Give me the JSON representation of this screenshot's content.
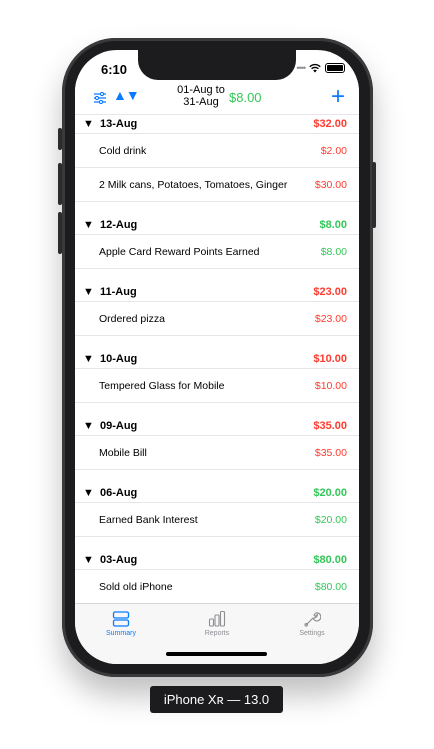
{
  "status": {
    "time": "6:10"
  },
  "navbar": {
    "range_from": "01-Aug to",
    "range_to": "31-Aug",
    "total": "$8.00",
    "add_label": "+"
  },
  "sections": [
    {
      "date": "13-Aug",
      "sum": "$32.00",
      "type": "red",
      "items": [
        {
          "desc": "Cold drink",
          "amount": "$2.00"
        },
        {
          "desc": "2 Milk cans, Potatoes, Tomatoes, Ginger",
          "amount": "$30.00"
        }
      ]
    },
    {
      "date": "12-Aug",
      "sum": "$8.00",
      "type": "green",
      "items": [
        {
          "desc": "Apple Card Reward Points Earned",
          "amount": "$8.00"
        }
      ]
    },
    {
      "date": "11-Aug",
      "sum": "$23.00",
      "type": "red",
      "items": [
        {
          "desc": "Ordered pizza",
          "amount": "$23.00"
        }
      ]
    },
    {
      "date": "10-Aug",
      "sum": "$10.00",
      "type": "red",
      "items": [
        {
          "desc": "Tempered Glass for Mobile",
          "amount": "$10.00"
        }
      ]
    },
    {
      "date": "09-Aug",
      "sum": "$35.00",
      "type": "red",
      "items": [
        {
          "desc": "Mobile Bill",
          "amount": "$35.00"
        }
      ]
    },
    {
      "date": "06-Aug",
      "sum": "$20.00",
      "type": "green",
      "items": [
        {
          "desc": "Earned Bank Interest",
          "amount": "$20.00"
        }
      ]
    },
    {
      "date": "03-Aug",
      "sum": "$80.00",
      "type": "green",
      "items": [
        {
          "desc": "Sold old iPhone",
          "amount": "$80.00"
        }
      ]
    }
  ],
  "tabs": [
    {
      "label": "Summary",
      "icon": "summary-icon",
      "active": true
    },
    {
      "label": "Reports",
      "icon": "reports-icon",
      "active": false
    },
    {
      "label": "Settings",
      "icon": "settings-icon",
      "active": false
    }
  ],
  "colors": {
    "accent": "#0a7aff",
    "expense": "#ff3b30",
    "income": "#34c759"
  },
  "caption": "iPhone Xʀ — 13.0"
}
